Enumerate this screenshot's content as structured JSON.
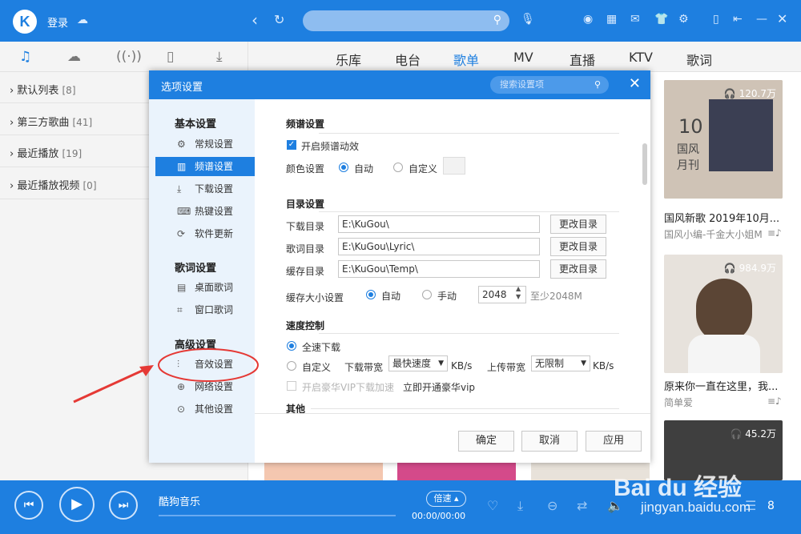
{
  "topbar": {
    "logo_letter": "K",
    "login_label": "登录",
    "search_placeholder": ""
  },
  "nav": {
    "categories": [
      "乐库",
      "电台",
      "歌单",
      "MV",
      "直播",
      "KTV",
      "歌词"
    ],
    "active_category": "歌单"
  },
  "sidebar": {
    "playlists": [
      {
        "name": "默认列表",
        "count": "[8]"
      },
      {
        "name": "第三方歌曲",
        "count": "[41]"
      },
      {
        "name": "最近播放",
        "count": "[19]"
      },
      {
        "name": "最近播放视频",
        "count": "[0]"
      }
    ]
  },
  "cards": [
    {
      "plays": "120.7万",
      "cover_text_1": "10",
      "cover_text_2": "国风",
      "cover_text_3": "月刊",
      "title": "国风新歌 2019年10月...",
      "subtitle": "国风小编-千金大小姐M"
    },
    {
      "plays": "984.9万",
      "title": "原来你一直在这里，我...",
      "subtitle": "简单爱"
    },
    {
      "plays": "45.2万"
    }
  ],
  "player": {
    "song": "酷狗音乐",
    "speed_label": "倍速",
    "time": "00:00/00:00",
    "count": "8"
  },
  "watermark": {
    "brand": "Bai du 经验",
    "url": "jingyan.baidu.com"
  },
  "dialog": {
    "title": "选项设置",
    "search_placeholder": "搜索设置项",
    "groups": [
      {
        "title": "基本设置",
        "items": [
          "常规设置",
          "频谱设置",
          "下载设置",
          "热键设置",
          "软件更新"
        ]
      },
      {
        "title": "歌词设置",
        "items": [
          "桌面歌词",
          "窗口歌词"
        ]
      },
      {
        "title": "高级设置",
        "items": [
          "音效设置",
          "网络设置",
          "其他设置"
        ]
      }
    ],
    "active_item": "频谱设置",
    "spectrum": {
      "section": "频谱设置",
      "enable_label": "开启频谱动效",
      "enabled": true,
      "color_label": "颜色设置",
      "color_auto": "自动",
      "color_custom": "自定义"
    },
    "dirs": {
      "section": "目录设置",
      "rows": [
        {
          "label": "下载目录",
          "path": "E:\\KuGou\\",
          "button": "更改目录"
        },
        {
          "label": "歌词目录",
          "path": "E:\\KuGou\\Lyric\\",
          "button": "更改目录"
        },
        {
          "label": "缓存目录",
          "path": "E:\\KuGou\\Temp\\",
          "button": "更改目录"
        }
      ],
      "cache_label": "缓存大小设置",
      "cache_auto": "自动",
      "cache_manual": "手动",
      "cache_value": "2048",
      "cache_min": "至少2048M"
    },
    "speed": {
      "section": "速度控制",
      "full": "全速下载",
      "custom": "自定义",
      "down_label": "下载带宽",
      "down_value": "最快速度",
      "down_unit": "KB/s",
      "up_label": "上传带宽",
      "up_value": "无限制",
      "up_unit": "KB/s",
      "vip_label": "开启豪华VIP下载加速",
      "vip_link": "立即开通豪华vip"
    },
    "other_section": "其他",
    "buttons": {
      "ok": "确定",
      "cancel": "取消",
      "apply": "应用"
    }
  }
}
